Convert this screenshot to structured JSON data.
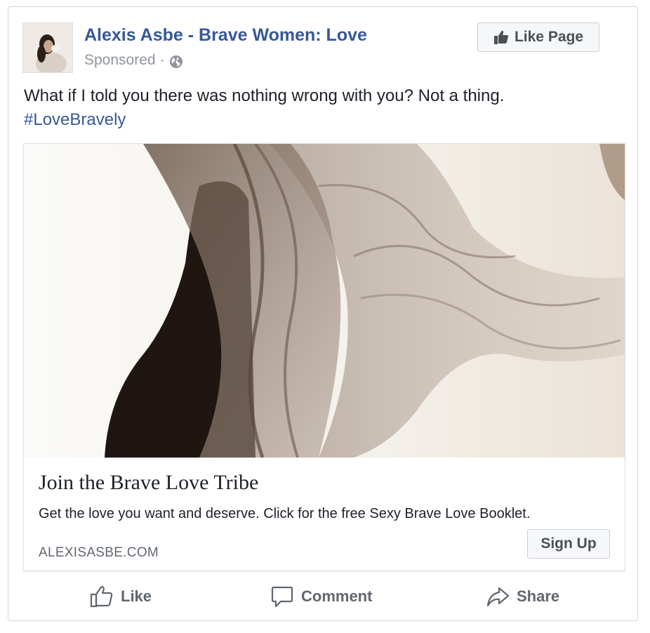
{
  "post": {
    "page_name": "Alexis Asbe - Brave Women: Love",
    "sponsored_label": "Sponsored",
    "separator": "·",
    "like_page_label": "Like Page",
    "message": "What if I told you there was nothing wrong with you? Not a thing.",
    "hashtag": "#LoveBravely"
  },
  "ad": {
    "headline": "Join the Brave Love Tribe",
    "description": "Get the love you want and deserve. Click for the free Sexy Brave Love Booklet.",
    "domain": "ALEXISASBE.COM",
    "cta_label": "Sign Up"
  },
  "actions": {
    "like_label": "Like",
    "comment_label": "Comment",
    "share_label": "Share"
  },
  "colors": {
    "link_blue": "#365899",
    "text": "#1d2129",
    "muted": "#90949c",
    "action_gray": "#606770"
  },
  "icons": {
    "like_page": "thumbs-up-icon",
    "audience": "globe-icon",
    "like": "thumbs-up-outline-icon",
    "comment": "speech-bubble-icon",
    "share": "share-arrow-icon"
  }
}
